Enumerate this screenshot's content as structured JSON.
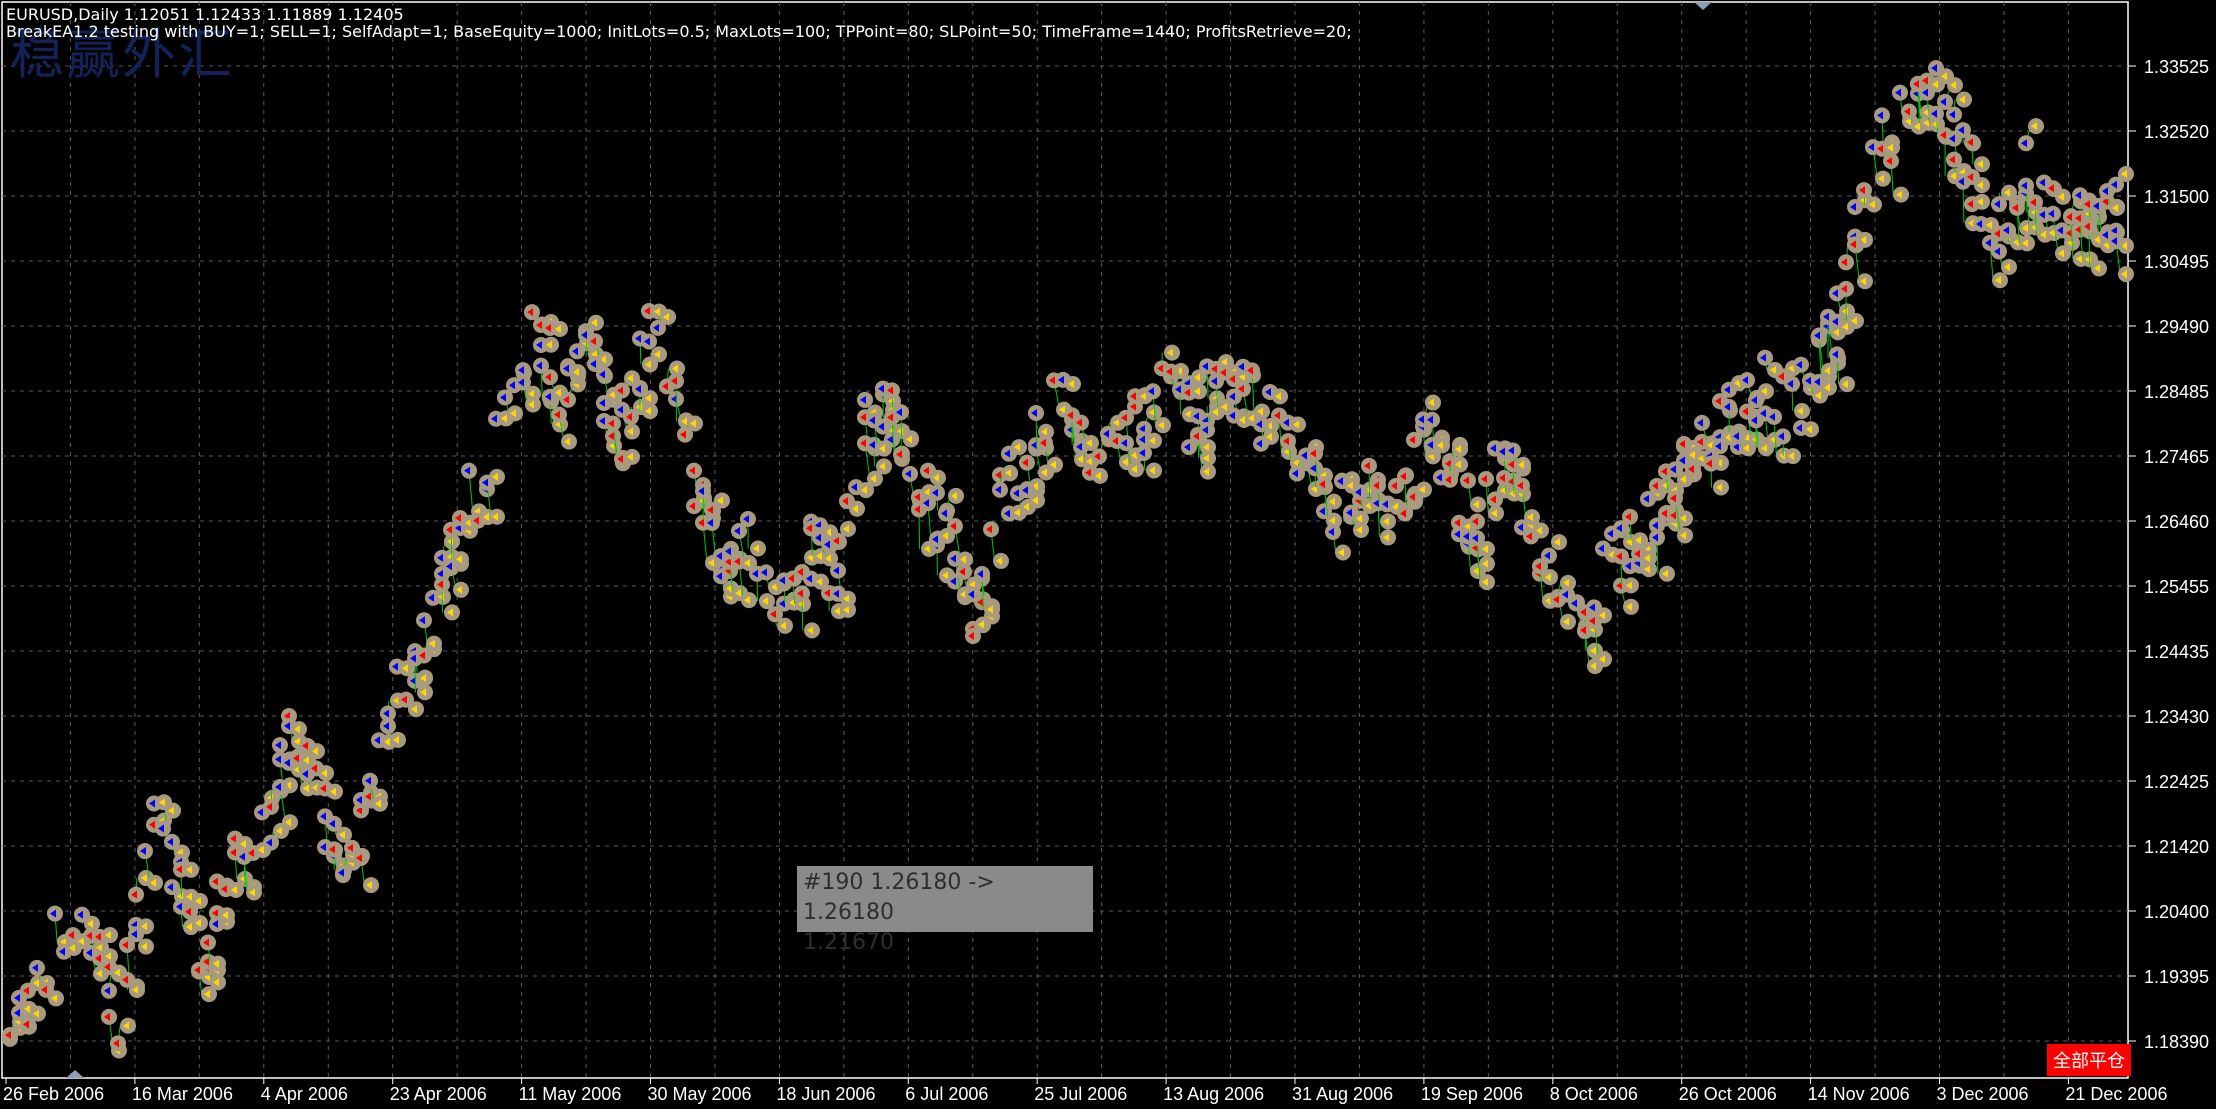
{
  "header": {
    "symbol_line": "EURUSD,Daily  1.12051 1.12433 1.11889 1.12405",
    "ea_line": "BreakEA1.2 testing with BUY=1; SELL=1; SelfAdapt=1; BaseEquity=1000; InitLots=0.5; MaxLots=100; TPPoint=80; SLPoint=50; TimeFrame=1440; ProfitsRetrieve=20;"
  },
  "watermark": "稳赢外汇",
  "tooltip": {
    "line1": "#190 1.26180 -> 1.26180",
    "line2": "1.21670"
  },
  "close_all_button": "全部平仓",
  "colors": {
    "background": "#000000",
    "grid": "#5a5a5a",
    "axis": "#ffffff",
    "order_line": "#00c800",
    "marker_ring": "#a89a80",
    "buy_arrow": "#0000ff",
    "sell_arrow": "#ff0000",
    "close_arrow": "#ffd700",
    "close_all_bg": "#ff0000"
  },
  "chart_data": {
    "type": "line",
    "symbol": "EURUSD",
    "timeframe": "Daily",
    "ylim": [
      1.1788,
      1.3405
    ],
    "grid": true,
    "y_ticks": [
      "1.33525",
      "1.32520",
      "1.31500",
      "1.30495",
      "1.29490",
      "1.28485",
      "1.27465",
      "1.26460",
      "1.25455",
      "1.24435",
      "1.23430",
      "1.22425",
      "1.21420",
      "1.20400",
      "1.19395",
      "1.18390"
    ],
    "x_ticks": [
      "26 Feb 2006",
      "16 Mar 2006",
      "4 Apr 2006",
      "23 Apr 2006",
      "11 May 2006",
      "30 May 2006",
      "18 Jun 2006",
      "6 Jul 2006",
      "25 Jul 2006",
      "13 Aug 2006",
      "31 Aug 2006",
      "19 Sep 2006",
      "8 Oct 2006",
      "26 Oct 2006",
      "14 Nov 2006",
      "3 Dec 2006",
      "21 Dec 2006"
    ],
    "series": [
      {
        "points": [
          [
            "26 Feb 2006",
            1.184
          ],
          [
            "1 Mar 2006",
            1.192
          ],
          [
            "6 Mar 2006",
            1.203
          ],
          [
            "10 Mar 2006",
            1.2
          ],
          [
            "14 Mar 2006",
            1.188
          ],
          [
            "18 Mar 2006",
            1.218
          ],
          [
            "22 Mar 2006",
            1.21
          ],
          [
            "26 Mar 2006",
            1.198
          ],
          [
            "30 Mar 2006",
            1.21
          ],
          [
            "4 Apr 2006",
            1.215
          ],
          [
            "8 Apr 2006",
            1.232
          ],
          [
            "12 Apr 2006",
            1.222
          ],
          [
            "16 Apr 2006",
            1.209
          ],
          [
            "20 Apr 2006",
            1.222
          ],
          [
            "23 Apr 2006",
            1.237
          ],
          [
            "27 Apr 2006",
            1.245
          ],
          [
            "1 May 2006",
            1.262
          ],
          [
            "5 May 2006",
            1.27
          ],
          [
            "9 May 2006",
            1.282
          ],
          [
            "13 May 2006",
            1.297
          ],
          [
            "17 May 2006",
            1.283
          ],
          [
            "21 May 2006",
            1.291
          ],
          [
            "25 May 2006",
            1.277
          ],
          [
            "30 May 2006",
            1.294
          ],
          [
            "3 Jun 2006",
            1.282
          ],
          [
            "7 Jun 2006",
            1.265
          ],
          [
            "11 Jun 2006",
            1.257
          ],
          [
            "15 Jun 2006",
            1.262
          ],
          [
            "18 Jun 2006",
            1.251
          ],
          [
            "22 Jun 2006",
            1.261
          ],
          [
            "26 Jun 2006",
            1.256
          ],
          [
            "30 Jun 2006",
            1.281
          ],
          [
            "4 Jul 2006",
            1.282
          ],
          [
            "8 Jul 2006",
            1.27
          ],
          [
            "12 Jul 2006",
            1.262
          ],
          [
            "16 Jul 2006",
            1.248
          ],
          [
            "20 Jul 2006",
            1.27
          ],
          [
            "25 Jul 2006",
            1.277
          ],
          [
            "29 Jul 2006",
            1.287
          ],
          [
            "2 Aug 2006",
            1.275
          ],
          [
            "6 Aug 2006",
            1.283
          ],
          [
            "10 Aug 2006",
            1.278
          ],
          [
            "13 Aug 2006",
            1.287
          ],
          [
            "17 Aug 2006",
            1.28
          ],
          [
            "21 Aug 2006",
            1.288
          ],
          [
            "25 Aug 2006",
            1.283
          ],
          [
            "31 Aug 2006",
            1.276
          ],
          [
            "4 Sep 2006",
            1.27
          ],
          [
            "8 Sep 2006",
            1.266
          ],
          [
            "12 Sep 2006",
            1.271
          ],
          [
            "16 Sep 2006",
            1.266
          ],
          [
            "19 Sep 2006",
            1.28
          ],
          [
            "23 Sep 2006",
            1.269
          ],
          [
            "27 Sep 2006",
            1.265
          ],
          [
            "1 Oct 2006",
            1.275
          ],
          [
            "5 Oct 2006",
            1.26
          ],
          [
            "8 Oct 2006",
            1.254
          ],
          [
            "12 Oct 2006",
            1.251
          ],
          [
            "16 Oct 2006",
            1.258
          ],
          [
            "20 Oct 2006",
            1.262
          ],
          [
            "26 Oct 2006",
            1.271
          ],
          [
            "30 Oct 2006",
            1.277
          ],
          [
            "3 Nov 2006",
            1.281
          ],
          [
            "7 Nov 2006",
            1.285
          ],
          [
            "11 Nov 2006",
            1.282
          ],
          [
            "14 Nov 2006",
            1.286
          ],
          [
            "18 Nov 2006",
            1.295
          ],
          [
            "22 Nov 2006",
            1.32
          ],
          [
            "26 Nov 2006",
            1.326
          ],
          [
            "30 Nov 2006",
            1.333
          ],
          [
            "3 Dec 2006",
            1.33
          ],
          [
            "7 Dec 2006",
            1.32
          ],
          [
            "11 Dec 2006",
            1.31
          ],
          [
            "15 Dec 2006",
            1.318
          ],
          [
            "21 Dec 2006",
            1.312
          ]
        ]
      }
    ]
  }
}
